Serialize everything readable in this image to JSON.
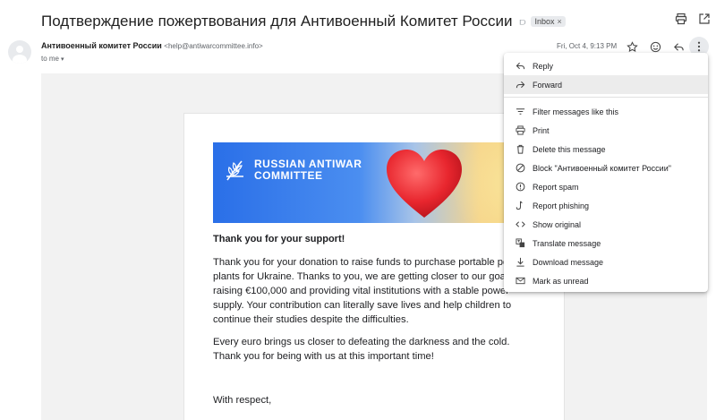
{
  "header": {
    "subject": "Подтверждение пожертвования для Антивоенный Комитет России",
    "label_chip": "Inbox",
    "label_chip_close": "×"
  },
  "message": {
    "sender_name": "Антивоенный комитет России",
    "sender_email": "<help@antiwarcommittee.info>",
    "to": "to me",
    "date": "Fri, Oct 4, 9:13 PM"
  },
  "email": {
    "banner_text": "RUSSIAN ANTIWAR\nCOMMITTEE",
    "title": "Thank you for your support!",
    "paragraph1": "Thank you for your donation to raise funds to purchase portable power plants for Ukraine. Thanks to you, we are getting closer to our goal of raising €100,000 and providing vital institutions with a stable power supply. Your contribution can literally save lives and help children to continue their studies despite the difficulties.",
    "paragraph2": "Every euro brings us closer to defeating the darkness and the cold. Thank you for being with us at this important time!",
    "regards": "With respect,"
  },
  "menu": {
    "items": [
      {
        "label": "Reply",
        "icon": "reply-icon"
      },
      {
        "label": "Forward",
        "icon": "forward-icon"
      },
      {
        "label": "Filter messages like this",
        "icon": "filter-icon"
      },
      {
        "label": "Print",
        "icon": "print-icon"
      },
      {
        "label": "Delete this message",
        "icon": "trash-icon"
      },
      {
        "label": "Block \"Антивоенный комитет России\"",
        "icon": "block-icon"
      },
      {
        "label": "Report spam",
        "icon": "spam-icon"
      },
      {
        "label": "Report phishing",
        "icon": "phishing-icon"
      },
      {
        "label": "Show original",
        "icon": "code-icon"
      },
      {
        "label": "Translate message",
        "icon": "translate-icon"
      },
      {
        "label": "Download message",
        "icon": "download-icon"
      },
      {
        "label": "Mark as unread",
        "icon": "mail-icon"
      }
    ],
    "highlighted_index": 1
  },
  "colors": {
    "banner_blue": "#2a6fe8",
    "banner_yellow": "#f7d67c",
    "heart_red": "#e8262e"
  }
}
